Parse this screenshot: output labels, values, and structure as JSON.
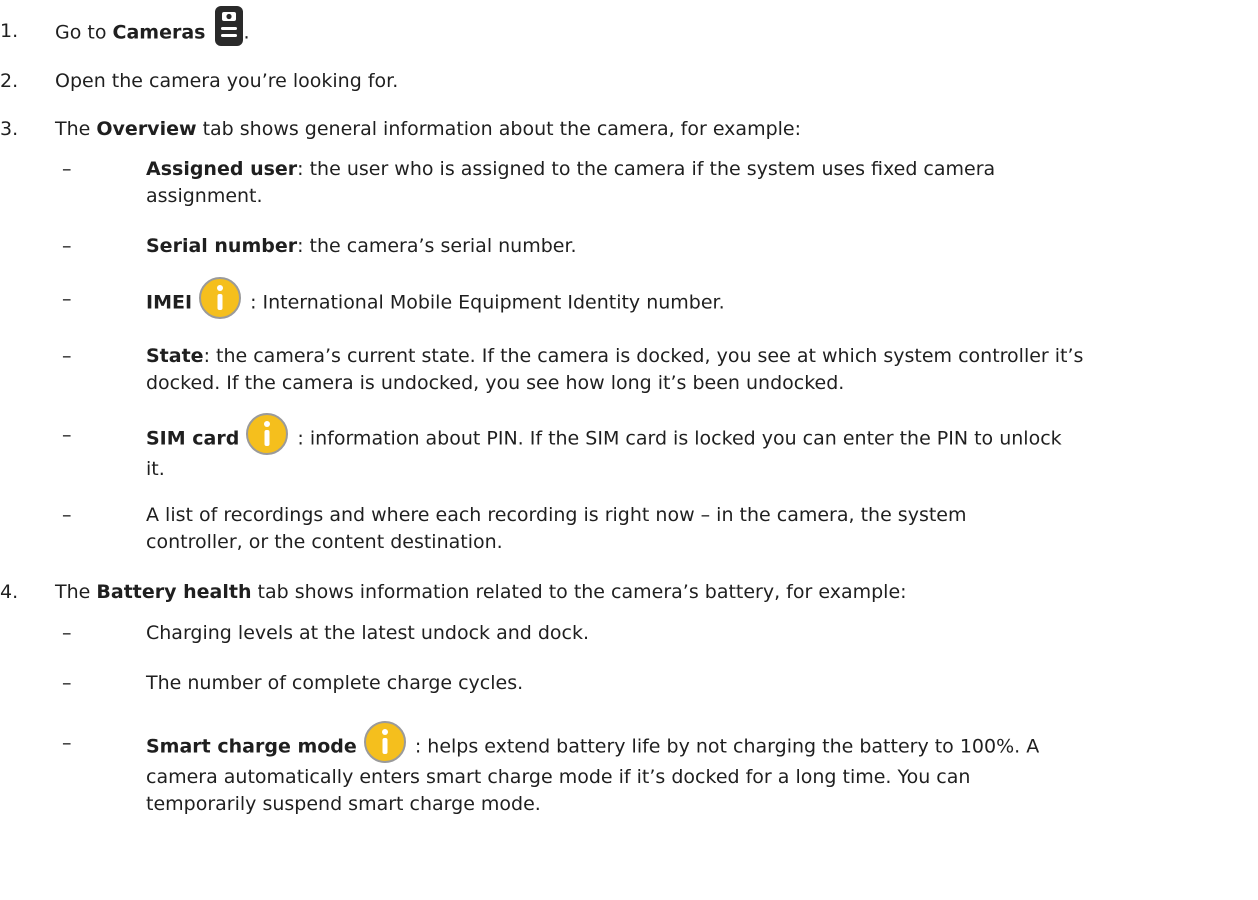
{
  "steps": [
    {
      "num": "1.",
      "pre": "Go to ",
      "bold": "Cameras",
      "icon": "camera-icon",
      "post": "."
    },
    {
      "num": "2.",
      "text": "Open the camera you’re looking for."
    },
    {
      "num": "3.",
      "pre": "The ",
      "bold": "Overview",
      "post": " tab shows general information about the camera, for example:",
      "items": [
        {
          "bold": "Assigned user",
          "text": ": the user who is assigned to the camera if the system uses fixed camera",
          "text2": "assignment."
        },
        {
          "bold": "Serial number",
          "text": ": the camera’s serial number."
        },
        {
          "bold": "IMEI",
          "icon": "info-icon",
          "text": " : International Mobile Equipment Identity number."
        },
        {
          "bold": "State",
          "text": ": the camera’s current state. If the camera is docked, you see at which system controller it’s",
          "text2": "docked. If the camera is undocked, you see how long it’s been undocked."
        },
        {
          "bold": "SIM card",
          "icon": "info-icon",
          "text": " : information about PIN. If the SIM card is locked you can enter the PIN to unlock",
          "text2": "it."
        },
        {
          "text": "A list of recordings and where each recording is right now – in the camera, the system",
          "text2": "controller, or the content destination."
        }
      ]
    },
    {
      "num": "4.",
      "pre": "The ",
      "bold": "Battery health",
      "post": " tab shows information related to the camera’s battery, for example:",
      "items": [
        {
          "text": "Charging levels at the latest undock and dock."
        },
        {
          "text": "The number of complete charge cycles."
        },
        {
          "bold": "Smart charge mode",
          "icon": "info-icon",
          "text": " : helps extend battery life by not charging the battery to 100%. A",
          "text2": "camera automatically enters smart charge mode if it’s docked for a long time. You can",
          "text3": "temporarily suspend smart charge mode."
        }
      ]
    }
  ],
  "dash": "–",
  "colors": {
    "info_icon": "#f5bf1d",
    "info_icon_ring": "#9a9a9a",
    "camera_icon": "#2a2a2a",
    "text": "#1f1f1f"
  }
}
